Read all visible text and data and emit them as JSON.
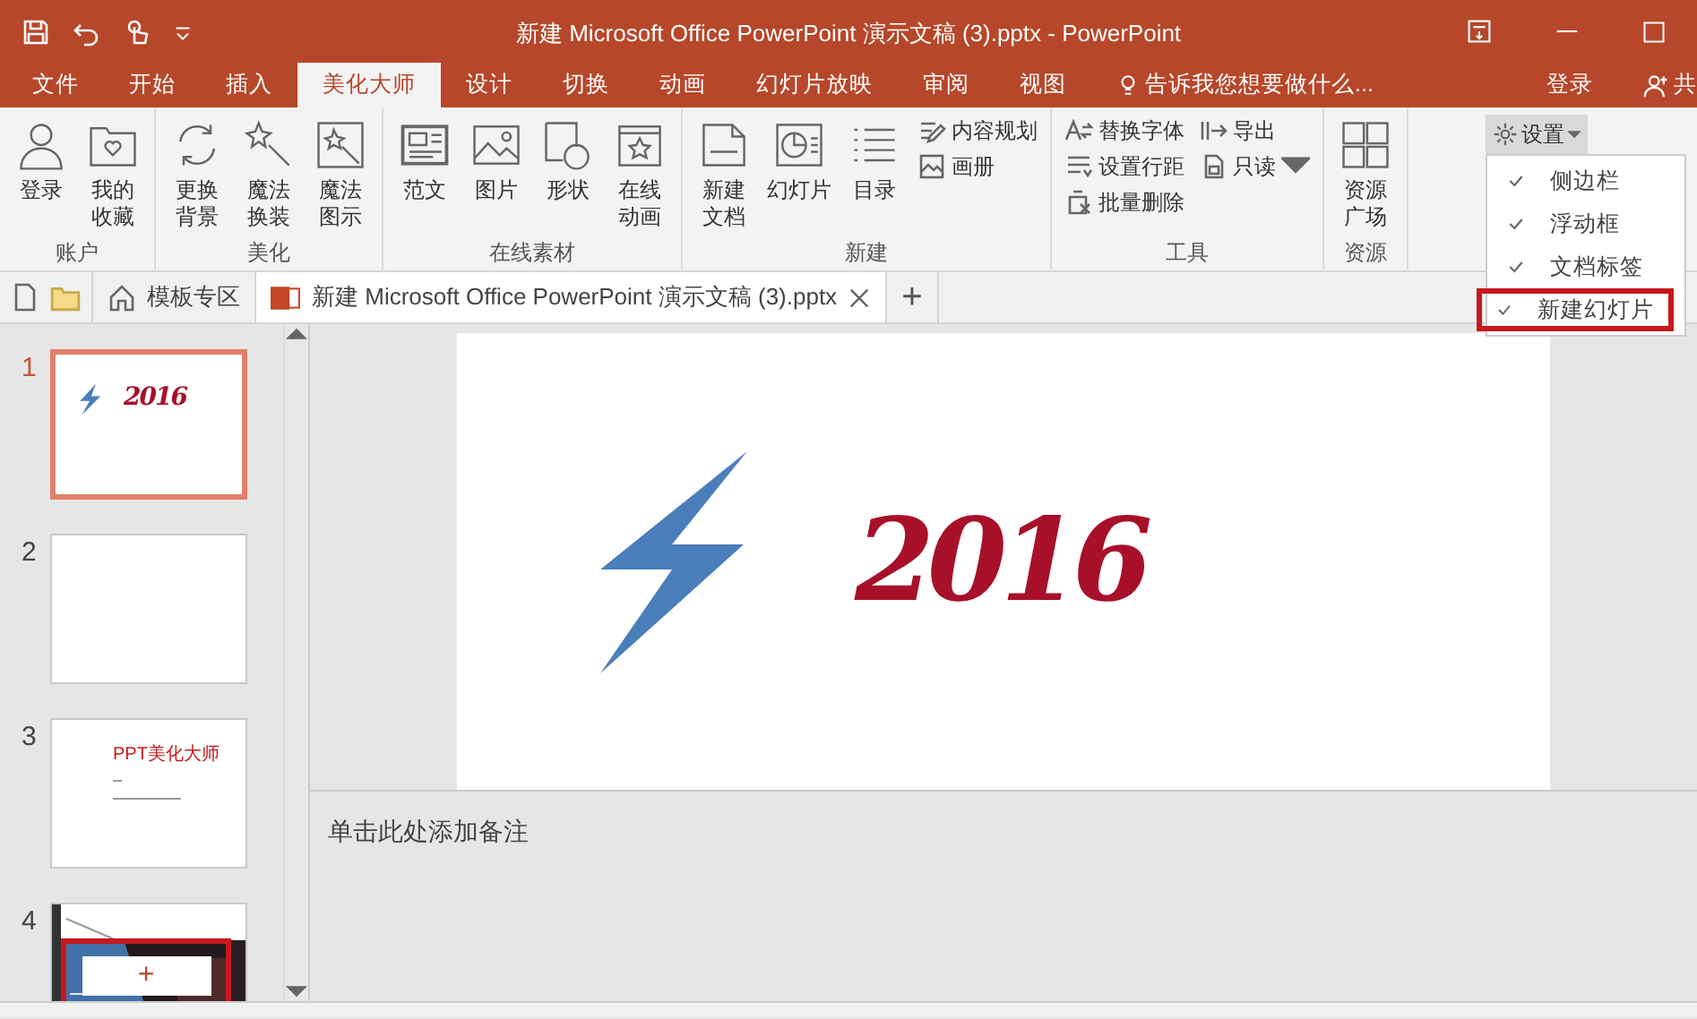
{
  "window": {
    "title": "新建 Microsoft Office PowerPoint 演示文稿 (3).pptx - PowerPoint"
  },
  "ribbon_tabs": [
    {
      "label": "文件",
      "selected": false
    },
    {
      "label": "开始",
      "selected": false
    },
    {
      "label": "插入",
      "selected": false
    },
    {
      "label": "美化大师",
      "selected": true
    },
    {
      "label": "设计",
      "selected": false
    },
    {
      "label": "切换",
      "selected": false
    },
    {
      "label": "动画",
      "selected": false
    },
    {
      "label": "幻灯片放映",
      "selected": false
    },
    {
      "label": "审阅",
      "selected": false
    },
    {
      "label": "视图",
      "selected": false
    }
  ],
  "tell_me": "告诉我您想要做什么...",
  "account": {
    "sign_in": "登录",
    "share": "共"
  },
  "ribbon_groups": [
    {
      "label": "账户",
      "items": [
        {
          "kind": "large",
          "label": "登录"
        },
        {
          "kind": "large",
          "label": "我的收藏"
        }
      ]
    },
    {
      "label": "美化",
      "items": [
        {
          "kind": "large",
          "label": "更换背景"
        },
        {
          "kind": "large",
          "label": "魔法换装"
        },
        {
          "kind": "large",
          "label": "魔法图示"
        }
      ]
    },
    {
      "label": "在线素材",
      "items": [
        {
          "kind": "large",
          "label": "范文"
        },
        {
          "kind": "large",
          "label": "图片"
        },
        {
          "kind": "large",
          "label": "形状"
        },
        {
          "kind": "large",
          "label": "在线动画"
        }
      ]
    },
    {
      "label": "新建",
      "items": [
        {
          "kind": "large",
          "label": "新建文档"
        },
        {
          "kind": "large",
          "label": "幻灯片"
        },
        {
          "kind": "large",
          "label": "目录"
        },
        {
          "kind": "stack",
          "items": [
            {
              "label": "内容规划",
              "dropdown": false
            },
            {
              "label": "画册",
              "dropdown": false
            }
          ]
        }
      ]
    },
    {
      "label": "工具",
      "items": [
        {
          "kind": "stack",
          "items": [
            {
              "label": "替换字体",
              "dropdown": false
            },
            {
              "label": "设置行距",
              "dropdown": false
            },
            {
              "label": "批量删除",
              "dropdown": false
            }
          ]
        },
        {
          "kind": "stack",
          "items": [
            {
              "label": "导出",
              "dropdown": false
            },
            {
              "label": "只读",
              "dropdown": true
            }
          ]
        }
      ]
    },
    {
      "label": "资源",
      "items": [
        {
          "kind": "large",
          "label": "资源广场"
        }
      ]
    }
  ],
  "settings_button": {
    "label": "设置",
    "pressed": true
  },
  "settings_menu": [
    {
      "label": "侧边栏",
      "checked": true,
      "highlighted": false
    },
    {
      "label": "浮动框",
      "checked": true,
      "highlighted": false
    },
    {
      "label": "文档标签",
      "checked": true,
      "highlighted": false
    },
    {
      "label": "新建幻灯片",
      "checked": true,
      "highlighted": true
    }
  ],
  "doc_tabs": {
    "template_tab": "模板专区",
    "documents": [
      {
        "title": "新建 Microsoft Office PowerPoint 演示文稿 (3).pptx",
        "selected": true
      }
    ],
    "add": "+"
  },
  "slides": [
    {
      "number": "1",
      "selected": true,
      "kind": "art",
      "art_text": "2016"
    },
    {
      "number": "2",
      "selected": false,
      "kind": "blank"
    },
    {
      "number": "3",
      "selected": false,
      "kind": "text",
      "title": "PPT美化大师"
    },
    {
      "number": "4",
      "selected": false,
      "kind": "picture"
    }
  ],
  "new_slide_button": {
    "label": "+",
    "highlighted": true
  },
  "slide": {
    "art_text": "2016"
  },
  "notes": {
    "placeholder": "单击此处添加备注"
  }
}
